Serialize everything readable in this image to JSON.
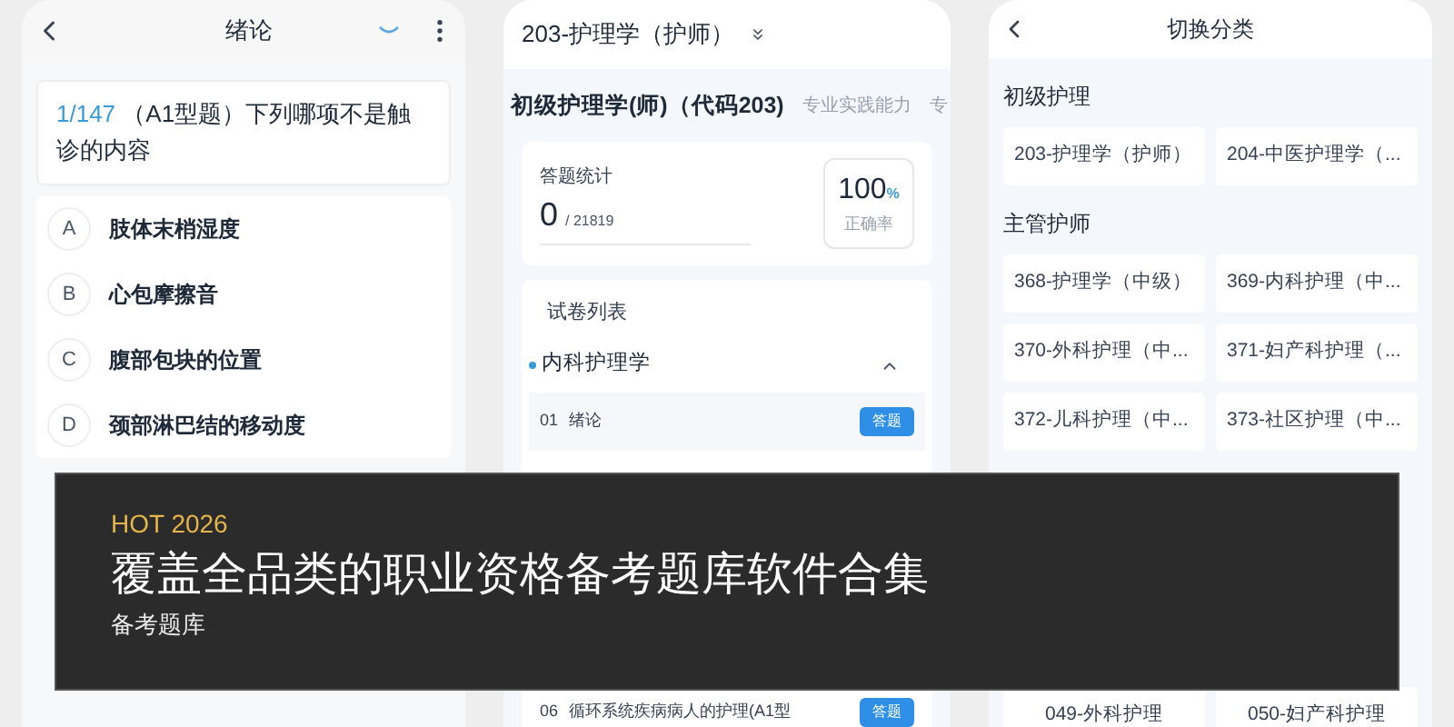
{
  "quiz_screen": {
    "title": "绪论",
    "question": {
      "index": "1/147",
      "text": "（A1型题）下列哪项不是触诊的内容"
    },
    "options": [
      {
        "letter": "A",
        "text": "肢体末梢湿度",
        "selected": false
      },
      {
        "letter": "B",
        "text": "心包摩擦音",
        "selected": false
      },
      {
        "letter": "C",
        "text": "腹部包块的位置",
        "selected": false
      },
      {
        "letter": "D",
        "text": "颈部淋巴结的移动度",
        "selected": false
      }
    ]
  },
  "paper_screen": {
    "subject": "203-护理学（护师）",
    "tabs": [
      {
        "label": "初级护理学(师)（代码203)",
        "selected": true
      },
      {
        "label": "专业实践能力",
        "selected": false
      },
      {
        "label": "专",
        "selected": false
      }
    ],
    "stats": {
      "label": "答题统计",
      "count": "0",
      "total": "/ 21819",
      "rate": "100",
      "rate_unit": "%",
      "rate_label": "正确率"
    },
    "list_title": "试卷列表",
    "group": {
      "name": "内科护理学",
      "expanded": true
    },
    "papers": [
      {
        "number": "01",
        "name": "绪论",
        "button": "答题",
        "selected": true
      },
      {
        "number": "06",
        "name": "循环系统疾病病人的护理(A1型",
        "button": "答题",
        "selected": false
      }
    ]
  },
  "category_screen": {
    "title": "切换分类",
    "sections": [
      {
        "name": "初级护理",
        "items": [
          "203-护理学（护师）",
          "204-中医护理学（..."
        ]
      },
      {
        "name": "主管护师",
        "items": [
          "368-护理学（中级）",
          "369-内科护理（中...",
          "370-外科护理（中...",
          "371-妇产科护理（...",
          "372-儿科护理（中...",
          "373-社区护理（中..."
        ]
      },
      {
        "items": [
          "049-外科护理",
          "050-妇产科护理"
        ]
      }
    ]
  },
  "banner": {
    "tag": "HOT 2026",
    "title": "覆盖全品类的职业资格备考题库软件合集",
    "subtitle": "备考题库"
  }
}
